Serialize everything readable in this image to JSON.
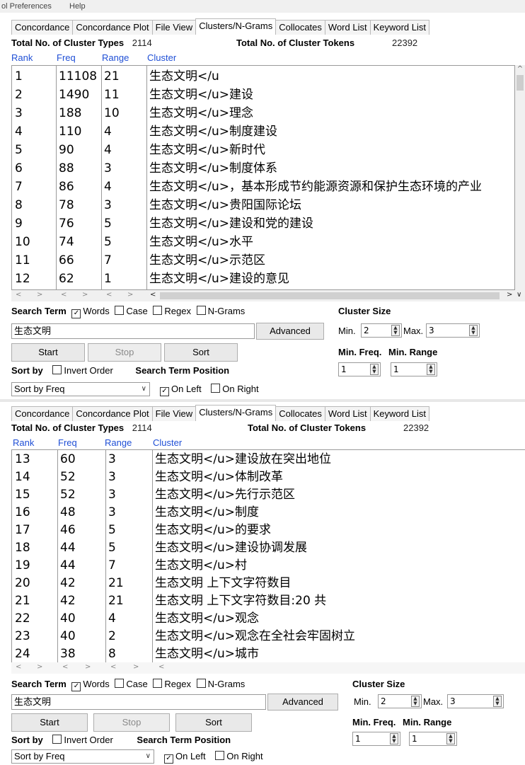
{
  "menu": {
    "items": [
      "ol Preferences",
      "Help"
    ]
  },
  "tabs": [
    "Concordance",
    "Concordance Plot",
    "File View",
    "Clusters/N-Grams",
    "Collocates",
    "Word List",
    "Keyword List"
  ],
  "active_tab": "Clusters/N-Grams",
  "totals": {
    "types_label": "Total No. of Cluster Types",
    "types_value": "2114",
    "tokens_label": "Total No. of Cluster Tokens",
    "tokens_value": "22392"
  },
  "columns": {
    "rank": "Rank",
    "freq": "Freq",
    "range": "Range",
    "cluster": "Cluster"
  },
  "panel1_rows": [
    {
      "rank": "1",
      "freq": "11108",
      "range": "21",
      "cluster": "生态文明</u"
    },
    {
      "rank": "2",
      "freq": "1490",
      "range": "11",
      "cluster": "生态文明</u>建设"
    },
    {
      "rank": "3",
      "freq": "188",
      "range": "10",
      "cluster": "生态文明</u>理念"
    },
    {
      "rank": "4",
      "freq": "110",
      "range": "4",
      "cluster": "生态文明</u>制度建设"
    },
    {
      "rank": "5",
      "freq": "90",
      "range": "4",
      "cluster": "生态文明</u>新时代"
    },
    {
      "rank": "6",
      "freq": "88",
      "range": "3",
      "cluster": "生态文明</u>制度体系"
    },
    {
      "rank": "7",
      "freq": "86",
      "range": "4",
      "cluster": "生态文明</u>，基本形成节约能源资源和保护生态环境的产业"
    },
    {
      "rank": "8",
      "freq": "78",
      "range": "3",
      "cluster": "生态文明</u>贵阳国际论坛"
    },
    {
      "rank": "9",
      "freq": "76",
      "range": "5",
      "cluster": "生态文明</u>建设和党的建设"
    },
    {
      "rank": "10",
      "freq": "74",
      "range": "5",
      "cluster": "生态文明</u>水平"
    },
    {
      "rank": "11",
      "freq": "66",
      "range": "7",
      "cluster": "生态文明</u>示范区"
    },
    {
      "rank": "12",
      "freq": "62",
      "range": "1",
      "cluster": "生态文明</u>建设的意见"
    }
  ],
  "panel2_rows": [
    {
      "rank": "13",
      "freq": "60",
      "range": "3",
      "cluster": "生态文明</u>建设放在突出地位"
    },
    {
      "rank": "14",
      "freq": "52",
      "range": "3",
      "cluster": "生态文明</u>体制改革"
    },
    {
      "rank": "15",
      "freq": "52",
      "range": "3",
      "cluster": "生态文明</u>先行示范区"
    },
    {
      "rank": "16",
      "freq": "48",
      "range": "3",
      "cluster": "生态文明</u>制度"
    },
    {
      "rank": "17",
      "freq": "46",
      "range": "5",
      "cluster": "生态文明</u>的要求"
    },
    {
      "rank": "18",
      "freq": "44",
      "range": "5",
      "cluster": "生态文明</u>建设协调发展"
    },
    {
      "rank": "19",
      "freq": "44",
      "range": "7",
      "cluster": "生态文明</u>村"
    },
    {
      "rank": "20",
      "freq": "42",
      "range": "21",
      "cluster": "生态文明 上下文字符数目"
    },
    {
      "rank": "21",
      "freq": "42",
      "range": "21",
      "cluster": "生态文明 上下文字符数目:20 共"
    },
    {
      "rank": "22",
      "freq": "40",
      "range": "4",
      "cluster": "生态文明</u>观念"
    },
    {
      "rank": "23",
      "freq": "40",
      "range": "2",
      "cluster": "生态文明</u>观念在全社会牢固树立"
    },
    {
      "rank": "24",
      "freq": "38",
      "range": "8",
      "cluster": "生态文明</u>城市"
    }
  ],
  "search": {
    "term_label": "Search Term",
    "words": "Words",
    "case": "Case",
    "regex": "Regex",
    "ngrams": "N-Grams",
    "value": "生态文明",
    "advanced": "Advanced",
    "start": "Start",
    "stop": "Stop",
    "sort": "Sort",
    "sort_by_label": "Sort by",
    "invert_order": "Invert Order",
    "position_label": "Search Term Position",
    "on_left": "On Left",
    "on_right": "On Right",
    "sort_select": "Sort by Freq"
  },
  "cluster_size": {
    "label": "Cluster Size",
    "min_label": "Min.",
    "min_value": "2",
    "max_label": "Max.",
    "max_value": "3",
    "min_freq_label": "Min. Freq.",
    "min_range_label": "Min. Range",
    "min_freq": "1",
    "min_range": "1"
  },
  "glyphs": {
    "check": "✓",
    "chevron": "∨",
    "up": "▲",
    "down": "▼"
  }
}
